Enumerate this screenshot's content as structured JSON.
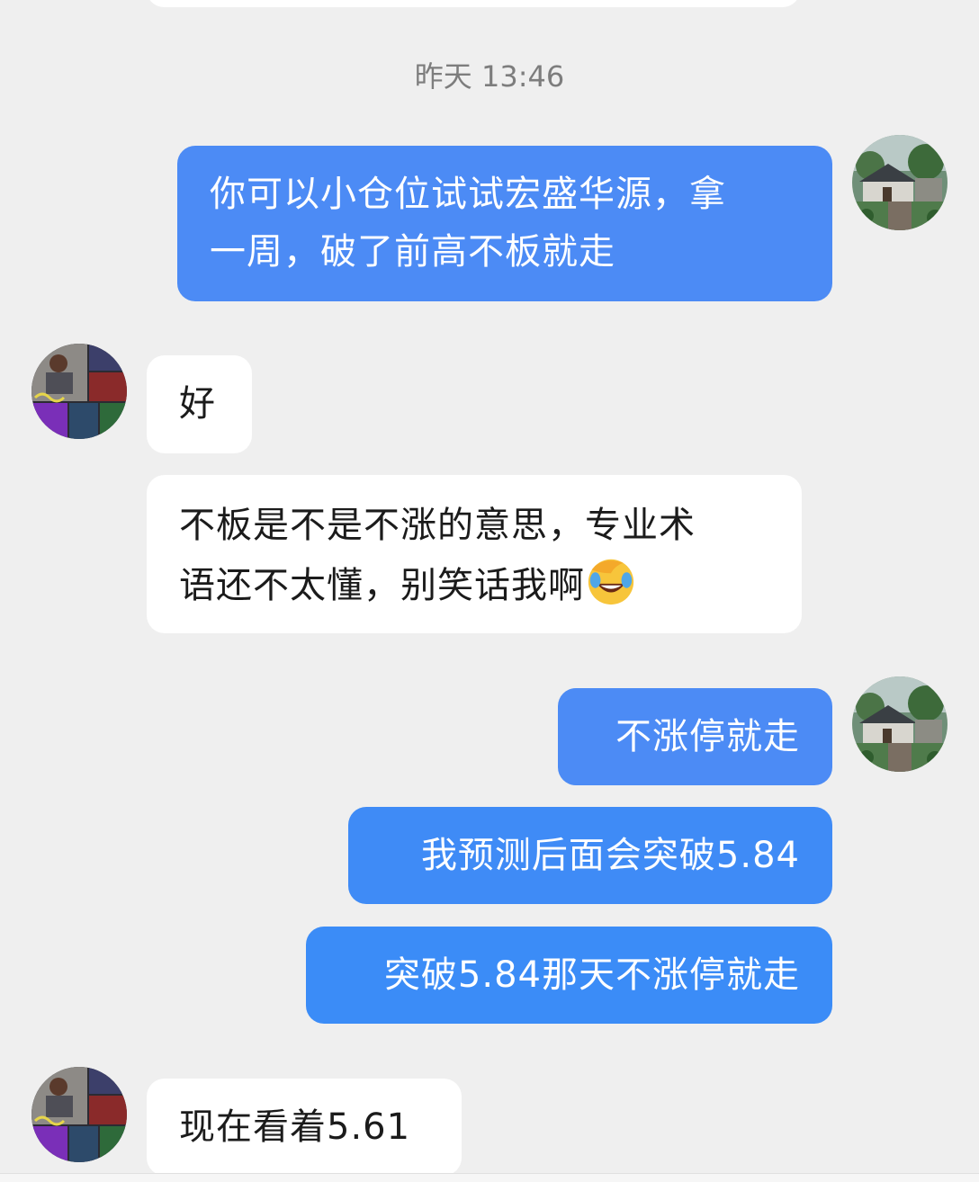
{
  "colors": {
    "background": "#efefef",
    "outgoing_bubble": "#4c8bf5",
    "incoming_bubble": "#ffffff",
    "timestamp_text": "#7d7d7d"
  },
  "timestamp": "昨天 13:46",
  "messages": [
    {
      "direction": "outgoing",
      "lines": [
        "你可以小仓位试试宏盛华源，拿",
        "一周，破了前高不板就走"
      ]
    },
    {
      "direction": "incoming",
      "text": "好"
    },
    {
      "direction": "incoming",
      "lines": [
        "不板是不是不涨的意思，专业术",
        "语还不太懂，别笑话我啊"
      ],
      "emoji": "face-palm-laughing-emoji"
    },
    {
      "direction": "outgoing",
      "text": "不涨停就走"
    },
    {
      "direction": "outgoing",
      "text": "我预测后面会突破5.84"
    },
    {
      "direction": "outgoing",
      "text": "突破5.84那天不涨停就走"
    },
    {
      "direction": "incoming",
      "text": "现在看着5.61"
    }
  ],
  "avatars": {
    "self": "landscape-village-avatar",
    "contact": "photo-collage-avatar"
  }
}
